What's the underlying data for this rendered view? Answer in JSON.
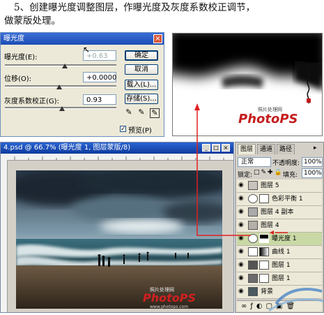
{
  "caption": {
    "line1": "5、创建曝光度调整图层，作曝光度及灰度系数校正调节，",
    "line2": "做蒙版处理。"
  },
  "dialog": {
    "title": "曝光度",
    "exposure_label": "曝光度(E):",
    "exposure_value": "+0.63",
    "offset_label": "位移(O):",
    "offset_value": "+0.0000",
    "gamma_label": "灰度系数校正(G):",
    "gamma_value": "0.93",
    "ok": "确定",
    "cancel": "取消",
    "load": "载入(L)...",
    "save": "存储(S)...",
    "preview": "预览(P)",
    "preview_checked": true
  },
  "preview": {
    "watermark_small": "照片处理网",
    "watermark_logo": "PhotoPS"
  },
  "document": {
    "title": "4.psd @ 66.7% (曝光度 1, 图层蒙版/8)",
    "watermark_small": "照片处理网",
    "watermark_logo": "PhotoPS",
    "watermark_url": "www.photops.com"
  },
  "layers_panel": {
    "tabs": [
      "图层",
      "通道",
      "路径"
    ],
    "blend_mode": "正常",
    "opacity_label": "不透明度:",
    "opacity_value": "100%",
    "lock_label": "锁定:",
    "fill_label": "填充:",
    "fill_value": "100%",
    "layers": [
      {
        "name": "图层 5"
      },
      {
        "name": "色彩平衡 1"
      },
      {
        "name": "图层 4 副本"
      },
      {
        "name": "图层 4"
      },
      {
        "name": "曝光度 1"
      },
      {
        "name": "曲线 1"
      },
      {
        "name": "图层 1"
      },
      {
        "name": "图层 1"
      },
      {
        "name": "背景"
      }
    ]
  },
  "colors": {
    "arrow": "#e02020",
    "selected_layer": "#c9d9a5",
    "titlebar": "#2a64d1"
  }
}
